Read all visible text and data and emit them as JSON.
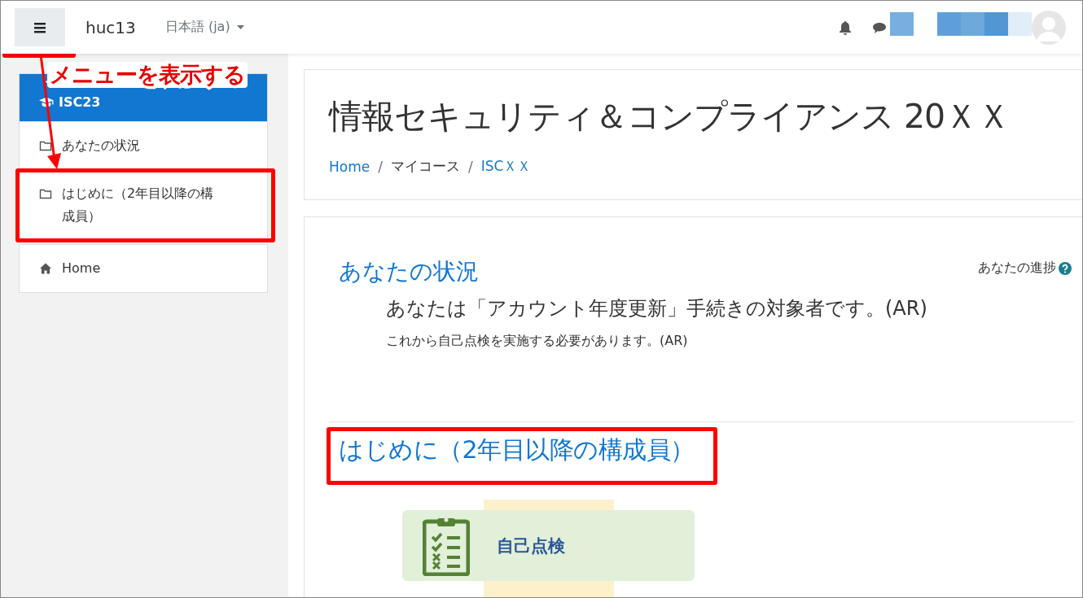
{
  "navbar": {
    "brand": "huc13",
    "language": "日本語 (ja)",
    "redacted_blocks": [
      {
        "color": "#77b0e0"
      },
      {
        "color": "#5f9fd9"
      },
      {
        "color": "#6ea9dc"
      },
      {
        "color": "#5296d4"
      },
      {
        "color": "#e1edf8"
      }
    ]
  },
  "sidebar": {
    "header": "ISC23",
    "items": [
      {
        "kind": "section",
        "label": "あなたの状況"
      },
      {
        "kind": "section",
        "label": "はじめに（2年目以降の構成員）"
      },
      {
        "kind": "home",
        "label": "Home"
      }
    ]
  },
  "page_header": {
    "title": "情報セキュリティ＆コンプライアンス 20ＸＸ",
    "breadcrumb_separators": [
      "/",
      "/"
    ],
    "breadcrumbs": [
      {
        "label": "Home",
        "link": true
      },
      {
        "label": "マイコース",
        "link": false
      },
      {
        "label": "ISCＸＸ",
        "link": true
      }
    ]
  },
  "sections": [
    {
      "title": "あなたの状況",
      "progress_label": "あなたの進捗",
      "lines": [
        {
          "text": "あなたは「アカウント年度更新」手続きの対象者です。(AR)",
          "kind": "lead"
        },
        {
          "text": "これから自己点検を実施する必要があります。(AR)",
          "kind": "note"
        }
      ]
    },
    {
      "title": "はじめに（2年目以降の構成員）",
      "activities": [
        {
          "label": "自己点検"
        }
      ]
    }
  ],
  "annotation": {
    "callout": "メニューを表示する"
  }
}
